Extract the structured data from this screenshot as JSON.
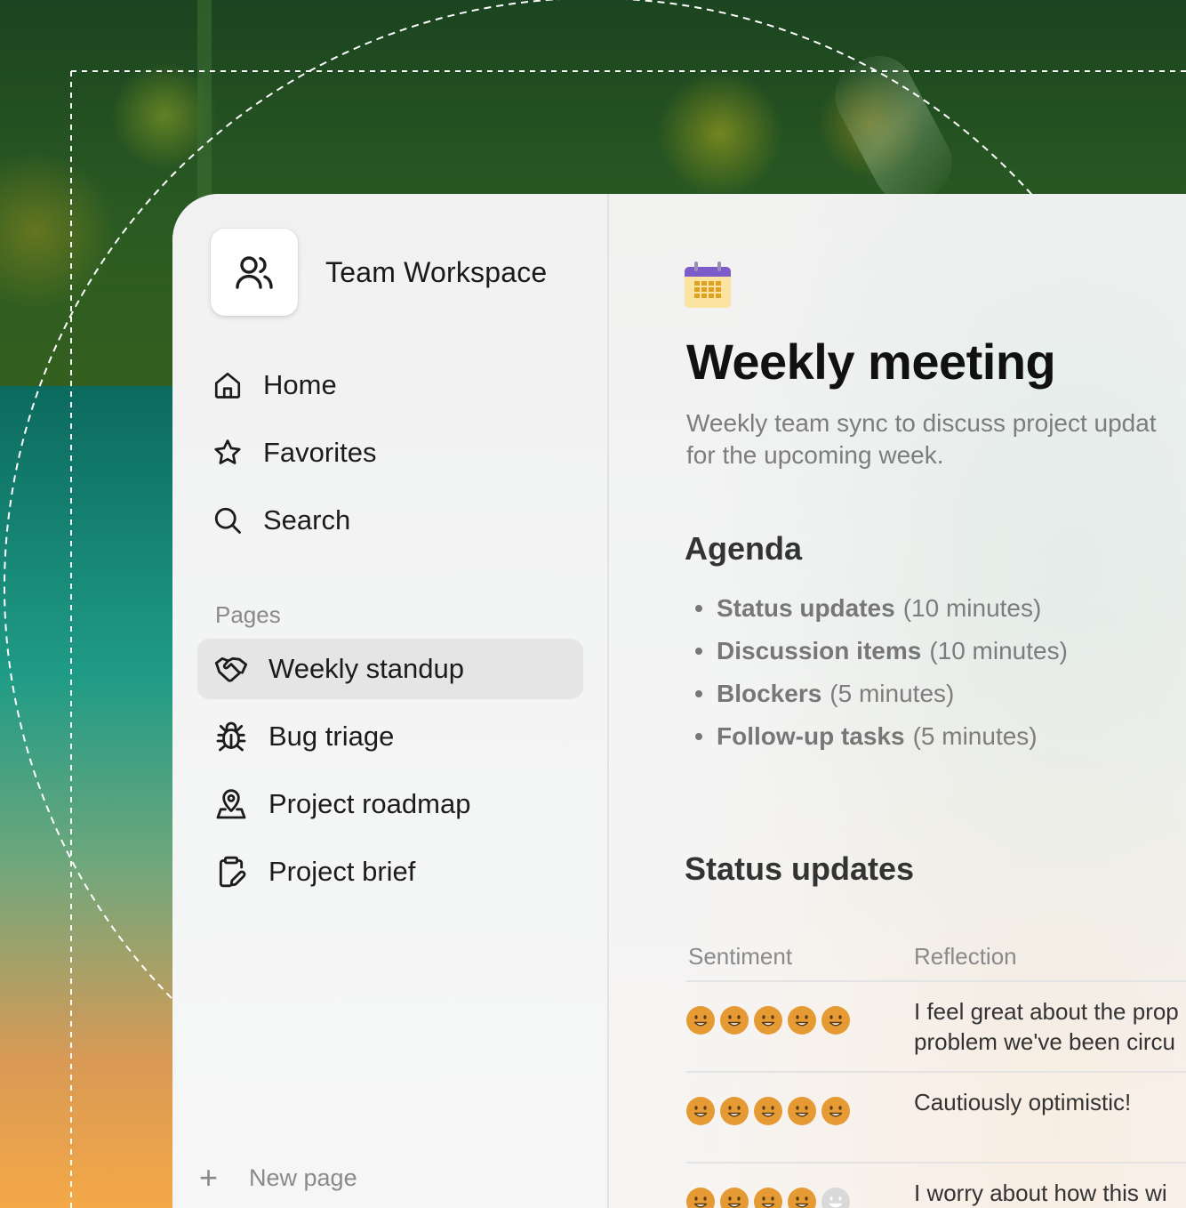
{
  "workspace": {
    "name": "Team Workspace",
    "icon": "users-icon"
  },
  "nav": [
    {
      "label": "Home",
      "icon": "home-icon"
    },
    {
      "label": "Favorites",
      "icon": "star-icon"
    },
    {
      "label": "Search",
      "icon": "search-icon"
    }
  ],
  "pages": {
    "heading": "Pages",
    "items": [
      {
        "label": "Weekly standup",
        "icon": "handshake-icon",
        "active": true
      },
      {
        "label": "Bug triage",
        "icon": "bug-icon",
        "active": false
      },
      {
        "label": "Project roadmap",
        "icon": "map-pin-icon",
        "active": false
      },
      {
        "label": "Project brief",
        "icon": "clipboard-edit-icon",
        "active": false
      }
    ],
    "new_page_label": "New page"
  },
  "document": {
    "icon": "calendar-icon",
    "title": "Weekly meeting",
    "description_line1": "Weekly team sync to discuss project updat",
    "description_line2": "for the upcoming week.",
    "agenda_heading": "Agenda",
    "agenda": [
      {
        "bold": "Status updates",
        "rest": "(10 minutes)"
      },
      {
        "bold": "Discussion items",
        "rest": "(10 minutes)"
      },
      {
        "bold": "Blockers",
        "rest": "(5 minutes)"
      },
      {
        "bold": "Follow-up tasks",
        "rest": "(5 minutes)"
      }
    ],
    "status_heading": "Status updates",
    "table": {
      "headers": [
        "Sentiment",
        "Reflection"
      ],
      "rows": [
        {
          "sentiment": 5,
          "lines": [
            "I feel great about the prop",
            "problem we've been circu"
          ]
        },
        {
          "sentiment": 5,
          "lines": [
            "Cautiously optimistic!"
          ]
        },
        {
          "sentiment": 4,
          "lines": [
            "I worry about how this wi"
          ]
        }
      ]
    }
  },
  "colors": {
    "accent_face": "#e59a33",
    "face_empty": "#d9d9d9",
    "active_row": "#e5e5e5"
  }
}
